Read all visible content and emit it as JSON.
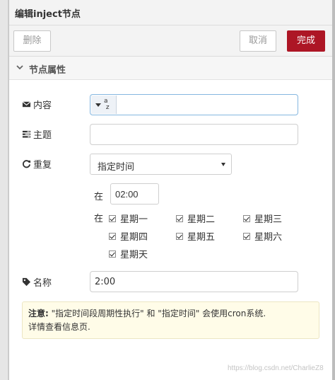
{
  "title": "编辑inject节点",
  "toolbar": {
    "delete_label": "删除",
    "cancel_label": "取消",
    "done_label": "完成"
  },
  "section": {
    "label": "节点属性",
    "icon": "chevron-down-icon"
  },
  "fields": {
    "payload": {
      "label": "内容",
      "icon": "envelope-icon",
      "type_indicator": "a z",
      "value": ""
    },
    "topic": {
      "label": "主题",
      "icon": "tasks-icon",
      "value": ""
    },
    "repeat": {
      "label": "重复",
      "icon": "repeat-icon",
      "selected": "指定时间"
    },
    "at_time_label": "在",
    "time_value": "02:00",
    "at_days_label": "在",
    "days": [
      {
        "label": "星期一",
        "checked": true
      },
      {
        "label": "星期二",
        "checked": true
      },
      {
        "label": "星期三",
        "checked": true
      },
      {
        "label": "星期四",
        "checked": true
      },
      {
        "label": "星期五",
        "checked": true
      },
      {
        "label": "星期六",
        "checked": true
      },
      {
        "label": "星期天",
        "checked": true
      }
    ],
    "name": {
      "label": "名称",
      "icon": "tag-icon",
      "value": "2:00"
    }
  },
  "note": {
    "prefix": "注意:",
    "line1": " \"指定时间段周期性执行\" 和 \"指定时间\" 会使用cron系统.",
    "line2": "详情查看信息页."
  },
  "watermark": "https://blog.csdn.net/CharlieZ8",
  "colors": {
    "accent": "#ad1625",
    "focus_border": "#85b7e0",
    "note_bg": "#fffce8"
  }
}
